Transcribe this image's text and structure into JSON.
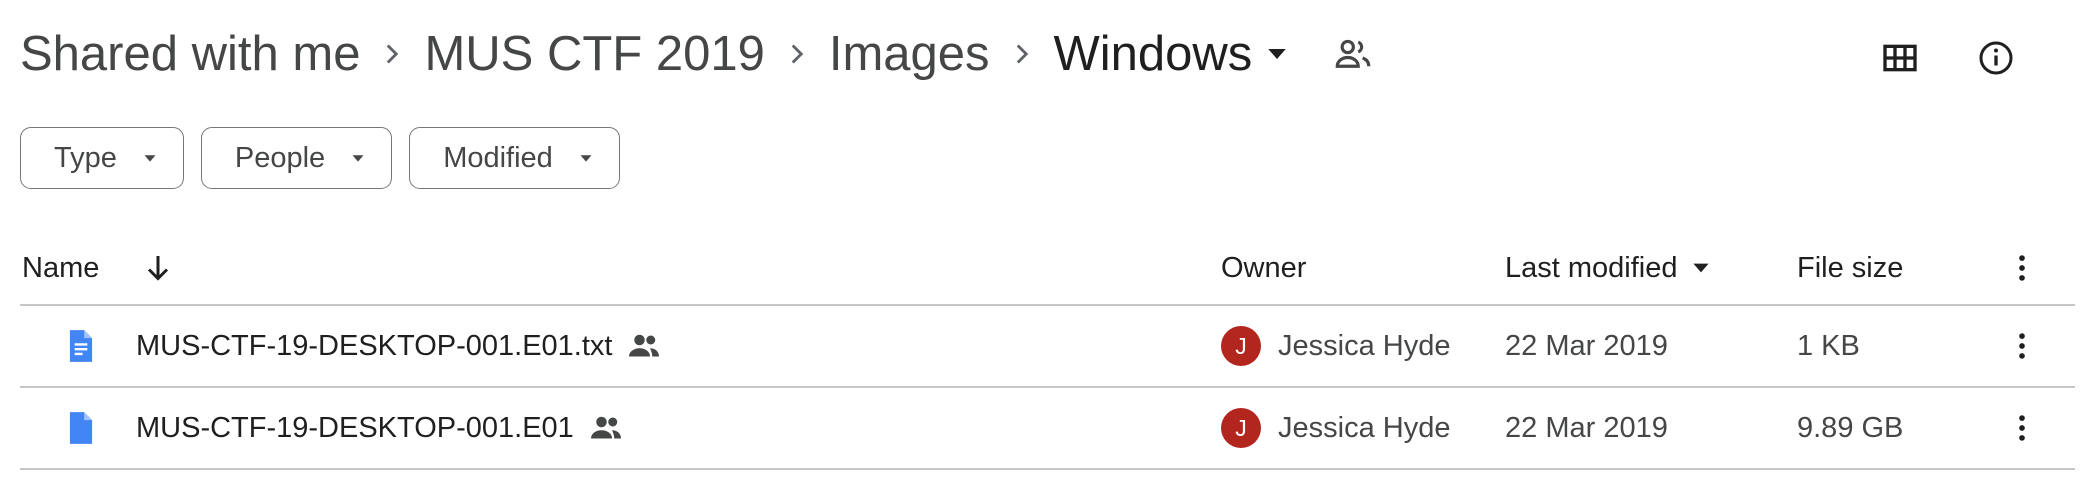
{
  "breadcrumb": {
    "items": [
      "Shared with me",
      "MUS CTF 2019",
      "Images"
    ],
    "current": "Windows"
  },
  "filters": [
    {
      "label": "Type"
    },
    {
      "label": "People"
    },
    {
      "label": "Modified"
    }
  ],
  "columns": {
    "name": "Name",
    "owner": "Owner",
    "last_modified": "Last modified",
    "file_size": "File size"
  },
  "files": [
    {
      "name": "MUS-CTF-19-DESKTOP-001.E01.txt",
      "icon": "google-docs-icon",
      "shared": true,
      "owner": "Jessica Hyde",
      "owner_initial": "J",
      "modified": "22 Mar 2019",
      "size": "1 KB"
    },
    {
      "name": "MUS-CTF-19-DESKTOP-001.E01",
      "icon": "file-icon",
      "shared": true,
      "owner": "Jessica Hyde",
      "owner_initial": "J",
      "modified": "22 Mar 2019",
      "size": "9.89 GB"
    }
  ],
  "colors": {
    "doc_blue": "#4285f4",
    "avatar_red": "#b3261e",
    "text_primary": "#1f1f1f",
    "text_secondary": "#444746"
  }
}
